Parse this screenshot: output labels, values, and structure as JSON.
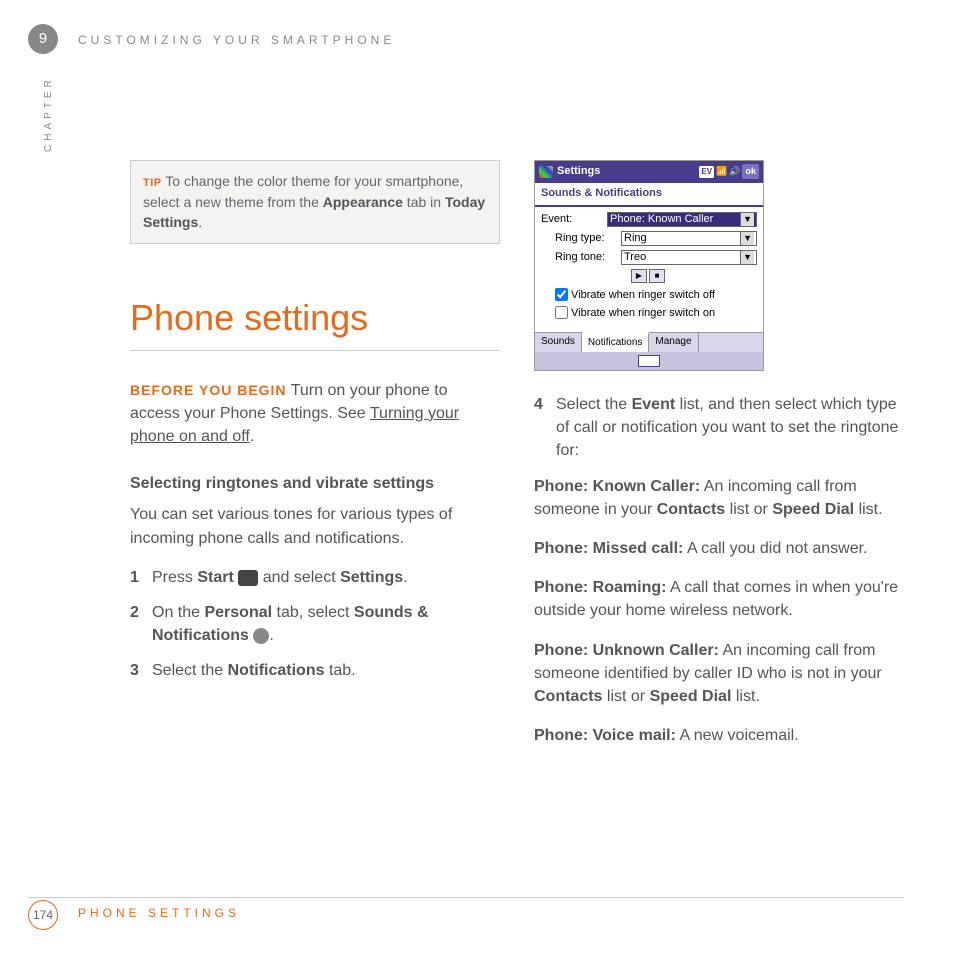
{
  "chapter": {
    "number": "9",
    "label": "CHAPTER",
    "title_top": "CUSTOMIZING YOUR SMARTPHONE"
  },
  "tip": {
    "label": "TIP",
    "text_a": " To change the color theme for your smartphone, select a new theme from the ",
    "bold_a": "Appearance",
    "text_b": " tab in ",
    "bold_b": "Today Settings",
    "text_c": "."
  },
  "section_title": "Phone settings",
  "before": {
    "label": "BEFORE YOU BEGIN",
    "text_a": "  Turn on your phone to access your Phone Settings. See ",
    "link": "Turning your phone on and off",
    "text_b": "."
  },
  "sub_heading": "Selecting ringtones and vibrate settings",
  "intro_para": "You can set various tones for various types of incoming phone calls and notifications.",
  "steps": {
    "s1": {
      "n": "1",
      "a": "Press ",
      "b1": "Start",
      "b": " ",
      "c": " and select ",
      "b2": "Settings",
      "d": "."
    },
    "s2": {
      "n": "2",
      "a": "On the ",
      "b1": "Personal",
      "b": " tab, select ",
      "b2": "Sounds & Notifications",
      "c": " ",
      "d": "."
    },
    "s3": {
      "n": "3",
      "a": "Select the ",
      "b1": "Notifications",
      "b": " tab."
    },
    "s4": {
      "n": "4",
      "a": "Select the ",
      "b1": "Event",
      "b": " list, and then select which type of call or notification you want to set the ringtone for:"
    }
  },
  "definitions": {
    "d1": {
      "term": "Phone: Known Caller:",
      "text_a": " An incoming call from someone in your ",
      "b1": "Contacts",
      "text_b": " list or ",
      "b2": "Speed Dial",
      "text_c": " list."
    },
    "d2": {
      "term": "Phone: Missed call:",
      "text": " A call you did not answer."
    },
    "d3": {
      "term": "Phone: Roaming:",
      "text": " A call that comes in when you're outside your home wireless network."
    },
    "d4": {
      "term": "Phone: Unknown Caller:",
      "text_a": " An incoming call from someone identified by caller ID who is not in your ",
      "b1": "Contacts",
      "text_b": " list or ",
      "b2": "Speed Dial",
      "text_c": " list."
    },
    "d5": {
      "term": "Phone: Voice mail:",
      "text": " A new voicemail."
    }
  },
  "screenshot": {
    "titlebar": "Settings",
    "status_pill": "EV",
    "ok": "ok",
    "subtitle": "Sounds & Notifications",
    "event_label": "Event:",
    "event_value": "Phone: Known Caller",
    "ringtype_label": "Ring type:",
    "ringtype_value": "Ring",
    "ringtone_label": "Ring tone:",
    "ringtone_value": "Treo",
    "check1": "Vibrate when ringer switch off",
    "check2": "Vibrate when ringer switch on",
    "tab1": "Sounds",
    "tab2": "Notifications",
    "tab3": "Manage"
  },
  "footer": {
    "page": "174",
    "title": "PHONE SETTINGS"
  }
}
